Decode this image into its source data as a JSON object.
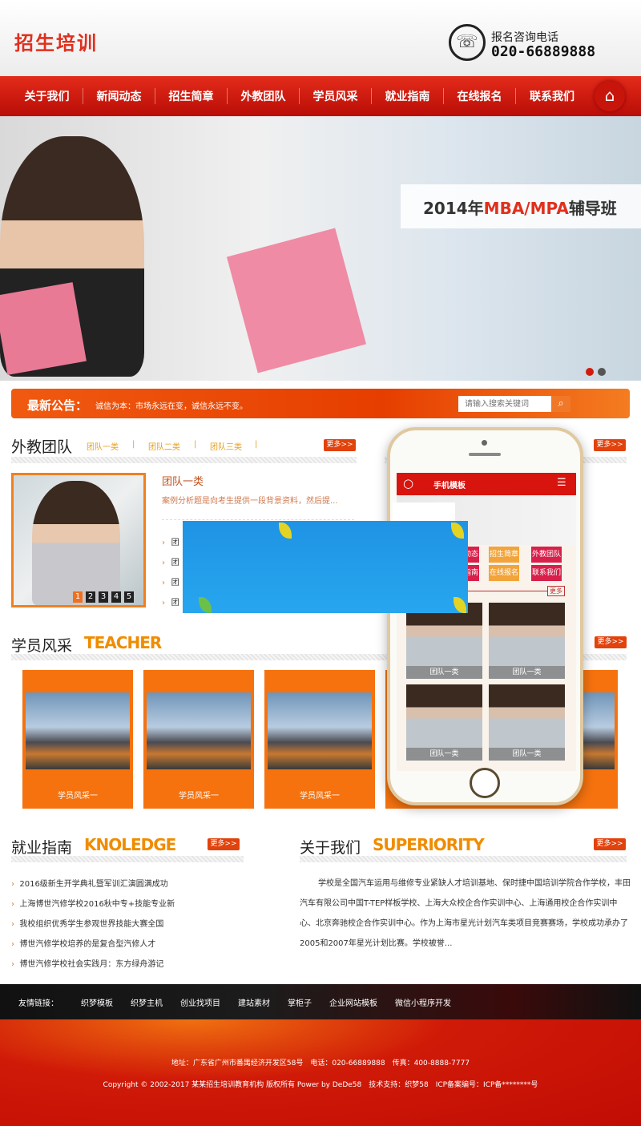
{
  "header": {
    "logo": "招生培训",
    "tel_label": "报名咨询电话",
    "tel": "020-66889888",
    "phone_icon": "phone-icon"
  },
  "nav": {
    "items": [
      "关于我们",
      "新闻动态",
      "招生简章",
      "外教团队",
      "学员风采",
      "就业指南",
      "在线报名",
      "联系我们"
    ],
    "home_icon": "home-icon"
  },
  "banner": {
    "caption_pre": "2014年",
    "caption_hl": "MBA/MPA",
    "caption_post": "辅导班",
    "slides": 2,
    "active_slide": 1
  },
  "notice": {
    "title": "最新公告：",
    "text": "诚信为本：市场永远在变，诚信永远不变。",
    "search_placeholder": "请输入搜索关键词"
  },
  "team": {
    "title": "外教团队",
    "tabs": [
      "团队一类",
      "团队二类",
      "团队三类"
    ],
    "more": "更多>>",
    "item_title": "团队一类",
    "item_desc": "案例分析题是向考生提供一段背景资料，然后提...",
    "list": [
      "团",
      "团",
      "团",
      "团"
    ],
    "pages": [
      "1",
      "2",
      "3",
      "4",
      "5"
    ],
    "active_page": "1"
  },
  "students": {
    "title": "学员风采",
    "en": "TEACHER",
    "more": "更多>>",
    "cards": [
      "学员风采一",
      "学员风采一",
      "学员风采一",
      "学员风采一"
    ]
  },
  "mobile": {
    "title": "手机模板",
    "buttons": [
      "新闻动态",
      "招生简章",
      "外教团队",
      "就业指南",
      "在线报名",
      "联系我们"
    ],
    "more": "更多",
    "tiles": [
      "团队一类",
      "团队一类",
      "团队一类",
      "团队一类"
    ],
    "colors": {
      "bar": "#d8140e",
      "btn_red": "#d8204a",
      "btn_orange": "#f2a43a"
    }
  },
  "jobs": {
    "title": "就业指南",
    "en": "KNOLEDGE",
    "more": "更多>>",
    "news": [
      "2016级新生开学典礼暨军训汇演圆满成功",
      "上海博世汽修学校2016秋中专+技能专业新",
      "我校组织优秀学生参观世界技能大赛全国",
      "博世汽修学校培养的是复合型汽修人才",
      "博世汽修学校社会实践月：东方绿舟游记"
    ]
  },
  "about": {
    "title": "关于我们",
    "en": "SUPERIORITY",
    "more": "更多>>",
    "text": "学校是全国汽车运用与维修专业紧缺人才培训基地、保时捷中国培训学院合作学校，丰田汽车有限公司中国T-TEP样板学校、上海大众校企合作实训中心、上海通用校企合作实训中心、北京奔驰校企合作实训中心。作为上海市星光计划汽车类项目竞赛赛场，学校成功承办了2005和2007年星光计划比赛。学校被誉..."
  },
  "links": {
    "label": "友情链接：",
    "items": [
      "织梦模板",
      "织梦主机",
      "创业找项目",
      "建站素材",
      "掌柜子",
      "企业网站模板",
      "微信小程序开发"
    ]
  },
  "footer": {
    "address": "地址：广东省广州市番禺经济开发区58号　电话：020-66889888　传真：400-8888-7777",
    "copyright": "Copyright © 2002-2017 某某招生培训教育机构 版权所有 Power by DeDe58　技术支持：织梦58　ICP备案编号：ICP备********号"
  },
  "colors": {
    "primary": "#d31a0c",
    "accent": "#f5720f",
    "gold": "#f08c00"
  }
}
